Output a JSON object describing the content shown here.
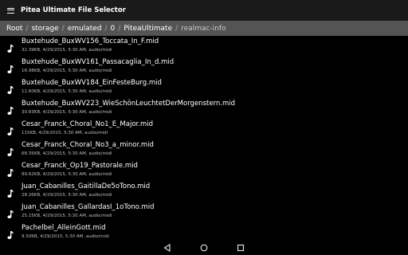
{
  "app": {
    "title": "Pitea Ultimate File Selector"
  },
  "icons": {
    "menu": "menu-icon",
    "file": "music-note-icon",
    "nav": [
      "back-icon",
      "home-icon",
      "recents-icon"
    ]
  },
  "breadcrumb": [
    "Root",
    "storage",
    "emulated",
    "0",
    "PiteaUltimate",
    "realmac-info"
  ],
  "files": [
    {
      "name": "Buxtehude_BuxWV156_Toccata_In_F.mid",
      "meta": "32.39KB, 4/29/2015, 5:30 AM, audio/midi"
    },
    {
      "name": "Buxtehude_BuxWV161_Passacaglia_In_d.mid",
      "meta": "16.98KB, 4/29/2015, 5:30 AM, audio/midi"
    },
    {
      "name": "Buxtehude_BuxWV184_EinFesteBurg.mid",
      "meta": "11.60KB, 4/29/2015, 5:30 AM, audio/midi"
    },
    {
      "name": "Buxtehude_BuxWV223_WieSchönLeuchtetDerMorgenstern.mid",
      "meta": "30.83KB, 4/29/2015, 5:30 AM, audio/midi"
    },
    {
      "name": "Cesar_Franck_Choral_No1_E_Major.mid",
      "meta": "115KB, 4/29/2015, 5:30 AM, audio/midi"
    },
    {
      "name": "Cesar_Franck_Choral_No3_a_minor.mid",
      "meta": "68.35KB, 4/29/2015, 5:30 AM, audio/midi"
    },
    {
      "name": "Cesar_Franck_Op19_Pastorale.mid",
      "meta": "89.62KB, 4/29/2015, 5:30 AM, audio/midi"
    },
    {
      "name": "Juan_Cabanilles_GaitillaDe5oTono.mid",
      "meta": "28.26KB, 4/29/2015, 5:30 AM, audio/midi"
    },
    {
      "name": "Juan_Cabanilles_GallardasI_1oTono.mid",
      "meta": "25.15KB, 4/29/2015, 5:30 AM, audio/midi"
    },
    {
      "name": "Pachelbel_AlleinGott.mid",
      "meta": "9.50KB, 4/29/2015, 5:30 AM, audio/midi"
    }
  ]
}
